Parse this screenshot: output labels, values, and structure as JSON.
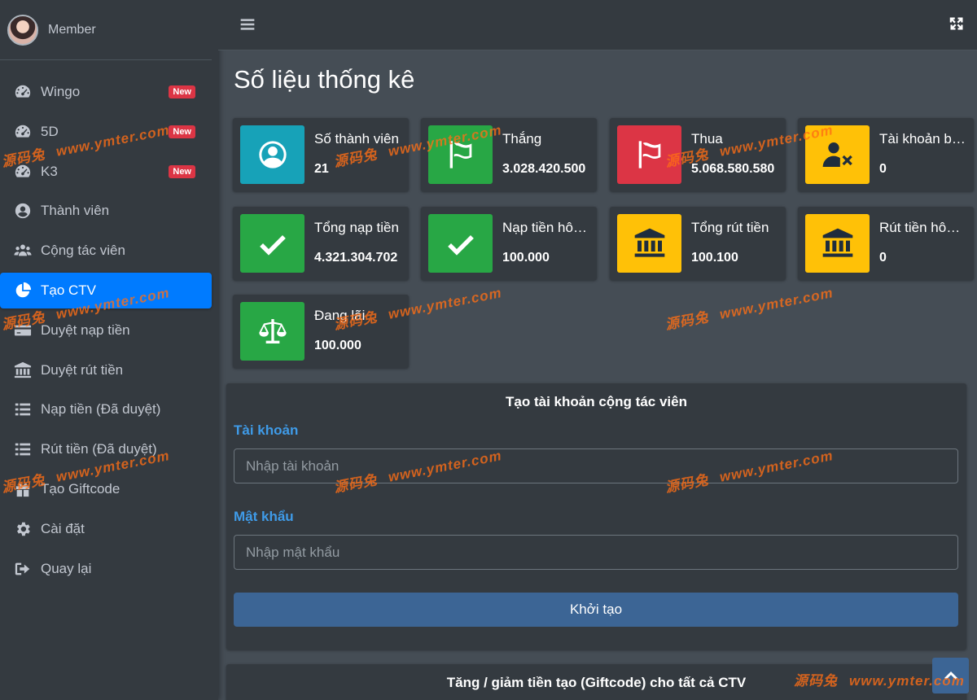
{
  "user": {
    "name": "Member"
  },
  "sidebar": {
    "items": [
      {
        "label": "Wingo",
        "badge": "New",
        "icon": "gauge-icon"
      },
      {
        "label": "5D",
        "badge": "New",
        "icon": "gauge-icon"
      },
      {
        "label": "K3",
        "badge": "New",
        "icon": "gauge-icon"
      },
      {
        "label": "Thành viên",
        "icon": "user-circle-icon"
      },
      {
        "label": "Cộng tác viên",
        "icon": "users-icon"
      },
      {
        "label": "Tạo CTV",
        "icon": "pie-chart-icon",
        "active": true
      },
      {
        "label": "Duyệt nạp tiền",
        "icon": "credit-card-icon"
      },
      {
        "label": "Duyệt rút tiền",
        "icon": "bank-icon"
      },
      {
        "label": "Nạp tiền (Đã duyệt)",
        "icon": "list-icon"
      },
      {
        "label": "Rút tiền (Đã duyệt)",
        "icon": "list-icon"
      },
      {
        "label": "Tạo Giftcode",
        "icon": "gift-icon"
      },
      {
        "label": "Cài đặt",
        "icon": "gear-icon"
      },
      {
        "label": "Quay lại",
        "icon": "sign-out-icon"
      }
    ]
  },
  "header": {
    "title": "Số liệu thống kê"
  },
  "stats": [
    {
      "label": "Số thành viên",
      "value": "21",
      "icon": "user-circle-icon",
      "color": "#17a2b8"
    },
    {
      "label": "Thắng",
      "value": "3.028.420.500",
      "icon": "flag-icon",
      "color": "#28a745"
    },
    {
      "label": "Thua",
      "value": "5.068.580.580",
      "icon": "flag-icon",
      "color": "#dc3545"
    },
    {
      "label": "Tài khoản bị khóa",
      "value": "0",
      "icon": "user-times-icon",
      "color": "#ffc107"
    },
    {
      "label": "Tổng nạp tiền",
      "value": "4.321.304.702",
      "icon": "check-icon",
      "color": "#28a745"
    },
    {
      "label": "Nạp tiền hôm nay",
      "value": "100.000",
      "icon": "check-icon",
      "color": "#28a745"
    },
    {
      "label": "Tổng rút tiền",
      "value": "100.100",
      "icon": "bank-icon",
      "color": "#ffc107"
    },
    {
      "label": "Rút tiền hôm nay",
      "value": "0",
      "icon": "bank-icon",
      "color": "#ffc107"
    },
    {
      "label": "Đang lãi",
      "value": "100.000",
      "icon": "balance-scale-icon",
      "color": "#28a745"
    }
  ],
  "form": {
    "title": "Tạo tài khoản cộng tác viên",
    "account_label": "Tài khoản",
    "account_placeholder": "Nhập tài khoản",
    "password_label": "Mật khẩu",
    "password_placeholder": "Nhập mật khẩu",
    "submit_label": "Khởi tạo"
  },
  "giftcode_card": {
    "title": "Tăng / giảm tiền tạo (Giftcode) cho tất cả CTV"
  },
  "watermark": {
    "cn": "源码兔",
    "url": "www.ymter.com"
  }
}
